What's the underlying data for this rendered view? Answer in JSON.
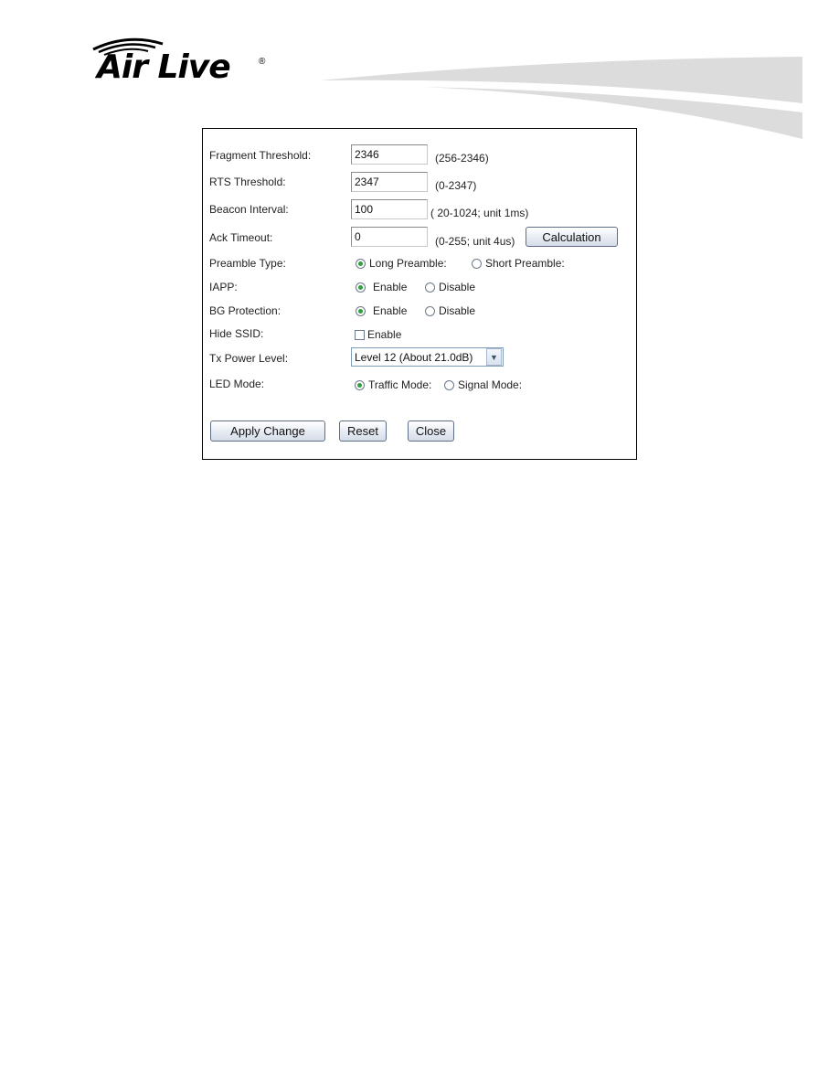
{
  "brand": {
    "name": "Air Live",
    "registered": "®"
  },
  "form": {
    "fragment_threshold": {
      "label": "Fragment Threshold:",
      "value": "2346",
      "hint": "(256-2346)"
    },
    "rts_threshold": {
      "label": "RTS Threshold:",
      "value": "2347",
      "hint": "(0-2347)"
    },
    "beacon_interval": {
      "label": "Beacon Interval:",
      "value": "100",
      "hint": "( 20-1024; unit 1ms)"
    },
    "ack_timeout": {
      "label": "Ack Timeout:",
      "value": "0",
      "hint": "(0-255; unit 4us)",
      "calc_button": "Calculation"
    },
    "preamble_type": {
      "label": "Preamble Type:",
      "options": [
        "Long Preamble:",
        "Short Preamble:"
      ],
      "selected": "Long Preamble:"
    },
    "iapp": {
      "label": "IAPP:",
      "options": [
        "Enable",
        "Disable"
      ],
      "selected": "Enable"
    },
    "bg_protection": {
      "label": "BG Protection:",
      "options": [
        "Enable",
        "Disable"
      ],
      "selected": "Enable"
    },
    "hide_ssid": {
      "label": "Hide SSID:",
      "checkbox_label": "Enable",
      "checked": false
    },
    "tx_power": {
      "label": "Tx Power Level:",
      "selected": "Level 12 (About 21.0dB)"
    },
    "led_mode": {
      "label": "LED Mode:",
      "options": [
        "Traffic Mode:",
        "Signal Mode:"
      ],
      "selected": "Traffic Mode:"
    }
  },
  "buttons": {
    "apply": "Apply Change",
    "reset": "Reset",
    "close": "Close"
  },
  "colors": {
    "radio_selected": "#2f9f3f",
    "swoosh": "#dcdcdc"
  }
}
